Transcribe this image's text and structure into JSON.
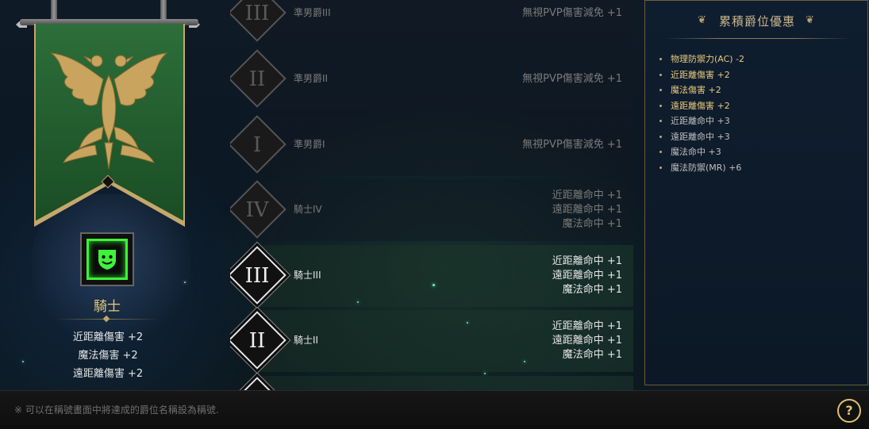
{
  "current_rank": {
    "name": "騎士",
    "icon": "knight-shield-face-icon",
    "bonuses": [
      "近距離傷害 +2",
      "魔法傷害 +2",
      "遠距離傷害 +2"
    ]
  },
  "rank_rows": [
    {
      "numeral": "III",
      "name": "準男爵III",
      "effects": [
        "無視PVP傷害減免 +1"
      ],
      "state": "locked"
    },
    {
      "numeral": "II",
      "name": "準男爵II",
      "effects": [
        "無視PVP傷害減免 +1"
      ],
      "state": "locked"
    },
    {
      "numeral": "I",
      "name": "準男爵I",
      "effects": [
        "無視PVP傷害減免 +1"
      ],
      "state": "locked"
    },
    {
      "numeral": "IV",
      "name": "騎士IV",
      "effects": [
        "近距離命中 +1",
        "遠距離命中 +1",
        "魔法命中 +1"
      ],
      "state": "locked"
    },
    {
      "numeral": "III",
      "name": "騎士III",
      "effects": [
        "近距離命中 +1",
        "遠距離命中 +1",
        "魔法命中 +1"
      ],
      "state": "achieved"
    },
    {
      "numeral": "II",
      "name": "騎士II",
      "effects": [
        "近距離命中 +1",
        "遠距離命中 +1",
        "魔法命中 +1"
      ],
      "state": "achieved"
    }
  ],
  "cumulative": {
    "title": "累積爵位優惠",
    "items": [
      {
        "text": "物理防禦力(AC) -2",
        "highlight": true
      },
      {
        "text": "近距離傷害 +2",
        "highlight": true
      },
      {
        "text": "魔法傷害 +2",
        "highlight": true
      },
      {
        "text": "遠距離傷害 +2",
        "highlight": true
      },
      {
        "text": "近距離命中 +3",
        "highlight": false
      },
      {
        "text": "遠距離命中 +3",
        "highlight": false
      },
      {
        "text": "魔法命中 +3",
        "highlight": false
      },
      {
        "text": "魔法防禦(MR) +6",
        "highlight": false
      }
    ]
  },
  "footer": {
    "note": "※ 可以在稱號畫面中將達成的爵位名稱設為稱號.",
    "help_label": "?"
  },
  "colors": {
    "gold": "#e8c97c",
    "banner_green": "#2d6e3a",
    "rank_icon_green": "#3ff13a"
  }
}
